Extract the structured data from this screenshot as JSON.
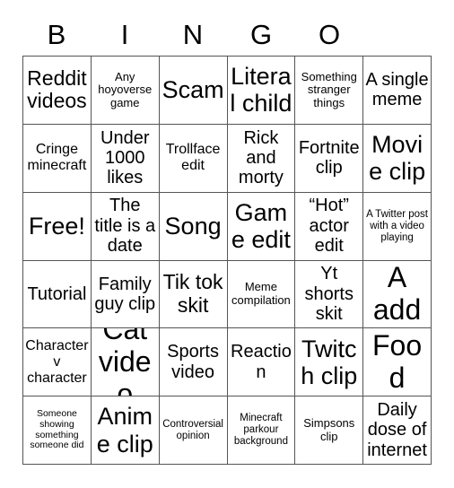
{
  "card": {
    "title": "BINGO",
    "header_letters": [
      "B",
      "I",
      "N",
      "G",
      "O",
      ""
    ],
    "columns": 6,
    "rows": 6,
    "border_color": "#555555",
    "background_color": "#ffffff",
    "text_color": "#000000",
    "cells": [
      {
        "text": "Reddit videos",
        "size": "lg",
        "row": 1,
        "col": 1
      },
      {
        "text": "Any hoyoverse game",
        "size": "xs",
        "row": 1,
        "col": 2
      },
      {
        "text": "Scam",
        "size": "xl",
        "row": 1,
        "col": 3
      },
      {
        "text": "Literal child",
        "size": "xl",
        "row": 1,
        "col": 4
      },
      {
        "text": "Something stranger things",
        "size": "xs",
        "row": 1,
        "col": 5
      },
      {
        "text": "A single meme",
        "size": "md",
        "row": 1,
        "col": 6
      },
      {
        "text": "Cringe minecraft",
        "size": "sm",
        "row": 2,
        "col": 1
      },
      {
        "text": "Under 1000 likes",
        "size": "md",
        "row": 2,
        "col": 2
      },
      {
        "text": "Trollface edit",
        "size": "sm",
        "row": 2,
        "col": 3
      },
      {
        "text": "Rick and morty",
        "size": "md",
        "row": 2,
        "col": 4
      },
      {
        "text": "Fortnite clip",
        "size": "md",
        "row": 2,
        "col": 5
      },
      {
        "text": "Movie clip",
        "size": "xl",
        "row": 2,
        "col": 6
      },
      {
        "text": "Free!",
        "size": "xl",
        "row": 3,
        "col": 1
      },
      {
        "text": "The title is a date",
        "size": "md",
        "row": 3,
        "col": 2
      },
      {
        "text": "Song",
        "size": "xl",
        "row": 3,
        "col": 3
      },
      {
        "text": "Game edit",
        "size": "xl",
        "row": 3,
        "col": 4
      },
      {
        "text": "“Hot” actor edit",
        "size": "md",
        "row": 3,
        "col": 5
      },
      {
        "text": "A Twitter post with a video playing",
        "size": "xxs",
        "row": 3,
        "col": 6
      },
      {
        "text": "Tutorial",
        "size": "md",
        "row": 4,
        "col": 1
      },
      {
        "text": "Family guy clip",
        "size": "md",
        "row": 4,
        "col": 2
      },
      {
        "text": "Tik tok skit",
        "size": "lg",
        "row": 4,
        "col": 3
      },
      {
        "text": "Meme compilation",
        "size": "xs",
        "row": 4,
        "col": 4
      },
      {
        "text": "Yt shorts skit",
        "size": "md",
        "row": 4,
        "col": 5
      },
      {
        "text": "A add",
        "size": "xxl",
        "row": 4,
        "col": 6
      },
      {
        "text": "Character v character",
        "size": "sm",
        "row": 5,
        "col": 1
      },
      {
        "text": "Cat video",
        "size": "xxl",
        "row": 5,
        "col": 2
      },
      {
        "text": "Sports video",
        "size": "md",
        "row": 5,
        "col": 3
      },
      {
        "text": "Reaction",
        "size": "md",
        "row": 5,
        "col": 4
      },
      {
        "text": "Twitch clip",
        "size": "xl",
        "row": 5,
        "col": 5
      },
      {
        "text": "Food",
        "size": "xxl",
        "row": 5,
        "col": 6
      },
      {
        "text": "Someone showing something someone did",
        "size": "tiny",
        "row": 6,
        "col": 1
      },
      {
        "text": "Anime clip",
        "size": "xl",
        "row": 6,
        "col": 2
      },
      {
        "text": "Controversial opinion",
        "size": "xxs",
        "row": 6,
        "col": 3
      },
      {
        "text": "Minecraft parkour background",
        "size": "xxs",
        "row": 6,
        "col": 4
      },
      {
        "text": "Simpsons clip",
        "size": "xs",
        "row": 6,
        "col": 5
      },
      {
        "text": "Daily dose of internet",
        "size": "md",
        "row": 6,
        "col": 6
      }
    ]
  }
}
